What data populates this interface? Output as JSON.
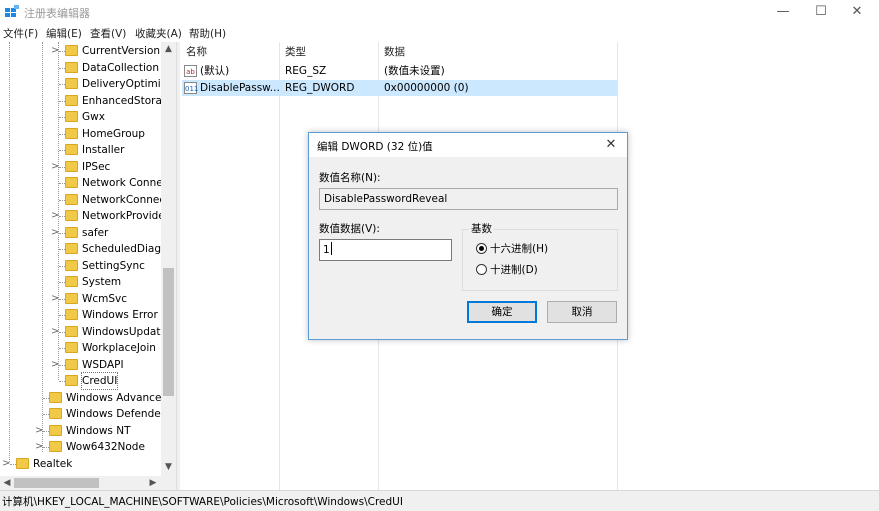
{
  "window": {
    "title": "注册表编辑器",
    "controls": {
      "minimize": "—",
      "maximize": "☐",
      "close": "✕"
    }
  },
  "menu": [
    "文件(F)",
    "编辑(E)",
    "查看(V)",
    "收藏夹(A)",
    "帮助(H)"
  ],
  "tree": {
    "items": [
      {
        "label": "CurrentVersion",
        "expandable": true
      },
      {
        "label": "DataCollection",
        "expandable": false
      },
      {
        "label": "DeliveryOptimiza",
        "expandable": false
      },
      {
        "label": "EnhancedStorag",
        "expandable": false
      },
      {
        "label": "Gwx",
        "expandable": false
      },
      {
        "label": "HomeGroup",
        "expandable": false
      },
      {
        "label": "Installer",
        "expandable": false
      },
      {
        "label": "IPSec",
        "expandable": true
      },
      {
        "label": "Network Connec",
        "expandable": false
      },
      {
        "label": "NetworkConnect",
        "expandable": false
      },
      {
        "label": "NetworkProvider",
        "expandable": true
      },
      {
        "label": "safer",
        "expandable": true
      },
      {
        "label": "ScheduledDiagn",
        "expandable": false
      },
      {
        "label": "SettingSync",
        "expandable": false
      },
      {
        "label": "System",
        "expandable": false
      },
      {
        "label": "WcmSvc",
        "expandable": true
      },
      {
        "label": "Windows Error F",
        "expandable": false
      },
      {
        "label": "WindowsUpdate",
        "expandable": true
      },
      {
        "label": "WorkplaceJoin",
        "expandable": false
      },
      {
        "label": "WSDAPI",
        "expandable": true
      },
      {
        "label": "CredUI",
        "expandable": false,
        "selected": true
      },
      {
        "label": "Windows Advanced",
        "expandable": false
      },
      {
        "label": "Windows Defender",
        "expandable": false
      },
      {
        "label": "Windows NT",
        "expandable": true
      },
      {
        "label": "Wow6432Node",
        "expandable": true
      },
      {
        "label": "Realtek",
        "expandable": true
      }
    ]
  },
  "list": {
    "headers": {
      "name": "名称",
      "type": "类型",
      "data": "数据"
    },
    "rows": [
      {
        "icon": "ab",
        "name": "(默认)",
        "type": "REG_SZ",
        "data": "(数值未设置)",
        "selected": false
      },
      {
        "icon": "011",
        "name": "DisablePassw...",
        "type": "REG_DWORD",
        "data": "0x00000000 (0)",
        "selected": true
      }
    ]
  },
  "status": {
    "path": "计算机\\HKEY_LOCAL_MACHINE\\SOFTWARE\\Policies\\Microsoft\\Windows\\CredUI"
  },
  "dialog": {
    "title": "编辑 DWORD (32 位)值",
    "close": "✕",
    "name_label": "数值名称(N):",
    "name_value": "DisablePasswordReveal",
    "data_label": "数值数据(V):",
    "data_value": "1",
    "base_label": "基数",
    "radio_hex": "十六进制(H)",
    "radio_dec": "十进制(D)",
    "base_selected": "hex",
    "ok": "确定",
    "cancel": "取消"
  }
}
